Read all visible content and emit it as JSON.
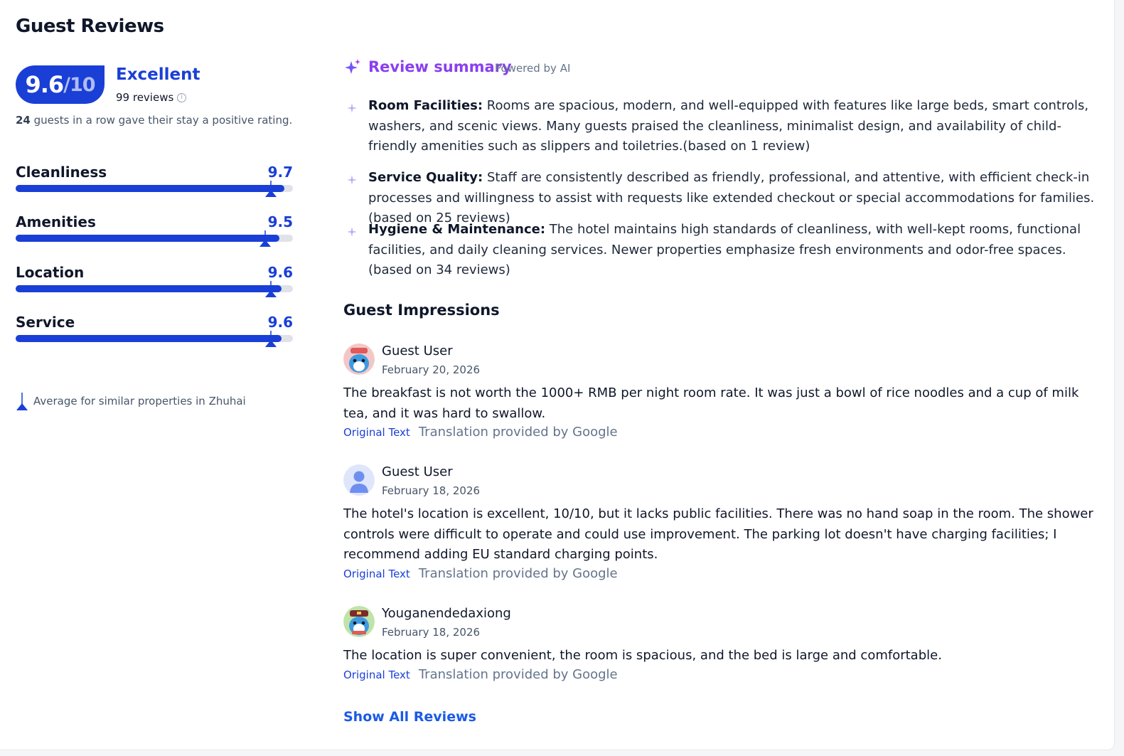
{
  "page": {
    "title": "Guest Reviews"
  },
  "overall": {
    "score": "9.6",
    "out_of": "/10",
    "rating_word": "Excellent",
    "review_count": "99 reviews",
    "info_icon_glyph": "i",
    "streak_count": "24",
    "streak_text": " guests in a row gave their stay a positive rating."
  },
  "categories": [
    {
      "name": "Cleanliness",
      "score": "9.7",
      "value": 9.7,
      "average": 9.2
    },
    {
      "name": "Amenities",
      "score": "9.5",
      "value": 9.5,
      "average": 9.0
    },
    {
      "name": "Location",
      "score": "9.6",
      "value": 9.6,
      "average": 9.2
    },
    {
      "name": "Service",
      "score": "9.6",
      "value": 9.6,
      "average": 9.2
    }
  ],
  "legend": {
    "text": "Average for similar properties in Zhuhai"
  },
  "summary": {
    "title": "Review summary",
    "powered": "Powered by AI",
    "items": [
      {
        "label": "Room Facilities:",
        "text": " Rooms are spacious, modern, and well-equipped with features like large beds, smart controls, washers, and scenic views. Many guests praised the cleanliness, minimalist design, and availability of child-friendly amenities such as slippers and toiletries.(based on 1 review)"
      },
      {
        "label": "Service Quality:",
        "text": " Staff are consistently described as friendly, professional, and attentive, with efficient check-in processes and willingness to assist with requests like extended checkout or special accommodations for families.(based on 25 reviews)"
      },
      {
        "label": "Hygiene & Maintenance:",
        "text": " The hotel maintains high standards of cleanliness, with well-kept rooms, functional facilities, and daily cleaning services. Newer properties emphasize fresh environments and odor-free spaces.(based on 34 reviews)"
      }
    ]
  },
  "impressions": {
    "title": "Guest Impressions",
    "reviews": [
      {
        "name": "Guest User",
        "date": "February 20, 2026",
        "text": "The breakfast is not worth the 1000+ RMB per night room rate. It was just a bowl of rice noodles and a cup of milk tea, and it was hard to swallow.",
        "original": "Original Text",
        "translation": "Translation provided by Google",
        "avatar": "dolphin-avatar-red"
      },
      {
        "name": "Guest User",
        "date": "February 18, 2026",
        "text": "The hotel's location is excellent, 10/10, but it lacks public facilities. There was no hand soap in the room. The shower controls were difficult to operate and could use improvement. The parking lot doesn't have charging facilities; I recommend adding EU standard charging points.",
        "original": "Original Text",
        "translation": "Translation provided by Google",
        "avatar": "default-user-avatar"
      },
      {
        "name": "Youganendedaxiong",
        "date": "February 18, 2026",
        "text": "The location is super convenient, the room is spacious, and the bed is large and comfortable.",
        "original": "Original Text",
        "translation": "Translation provided by Google",
        "avatar": "dolphin-avatar-green"
      }
    ],
    "show_all": "Show All Reviews"
  },
  "colors": {
    "brand": "#1a3fd6",
    "ai_purple": "#8a3ff0",
    "track": "#dfe2e8"
  }
}
